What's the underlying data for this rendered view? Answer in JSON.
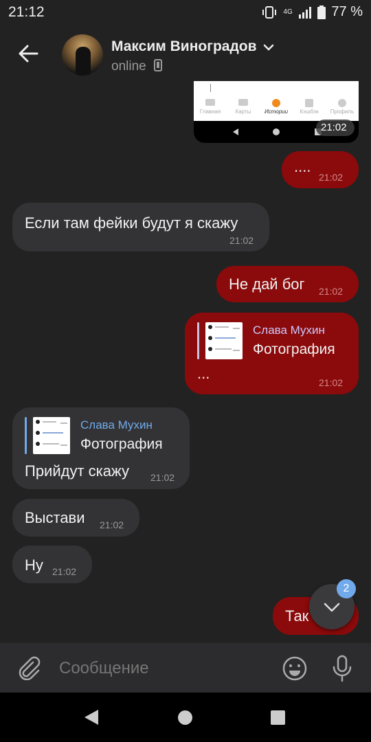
{
  "status_bar": {
    "time": "21:12",
    "network": "4G",
    "battery": "77 %"
  },
  "header": {
    "name": "Максим Виноградов",
    "status": "online"
  },
  "screenshot_preview": {
    "nav_items": [
      "Главная",
      "Карты",
      "Истории",
      "Кэшбэк",
      "Профиль"
    ],
    "time": "21:02"
  },
  "messages": [
    {
      "text": "....",
      "time": "21:02"
    },
    {
      "text": "Если там фейки будут я скажу",
      "time": "21:02"
    },
    {
      "text": "Не дай бог",
      "time": "21:02"
    },
    {
      "reply_name": "Слава Мухин",
      "reply_text": "Фотография",
      "text": "...",
      "time": "21:02"
    },
    {
      "reply_name": "Слава Мухин",
      "reply_text": "Фотография",
      "text": "Прийдут скажу",
      "time": "21:02"
    },
    {
      "text": "Выстави",
      "time": "21:02"
    },
    {
      "text": "Ну",
      "time": "21:02"
    },
    {
      "text": "Так"
    }
  ],
  "scroll_badge": "2",
  "composer": {
    "placeholder": "Сообщение"
  },
  "colors": {
    "outgoing": "#8b0a0b",
    "incoming": "#333335",
    "accent": "#71aaeb",
    "background": "#222222"
  }
}
